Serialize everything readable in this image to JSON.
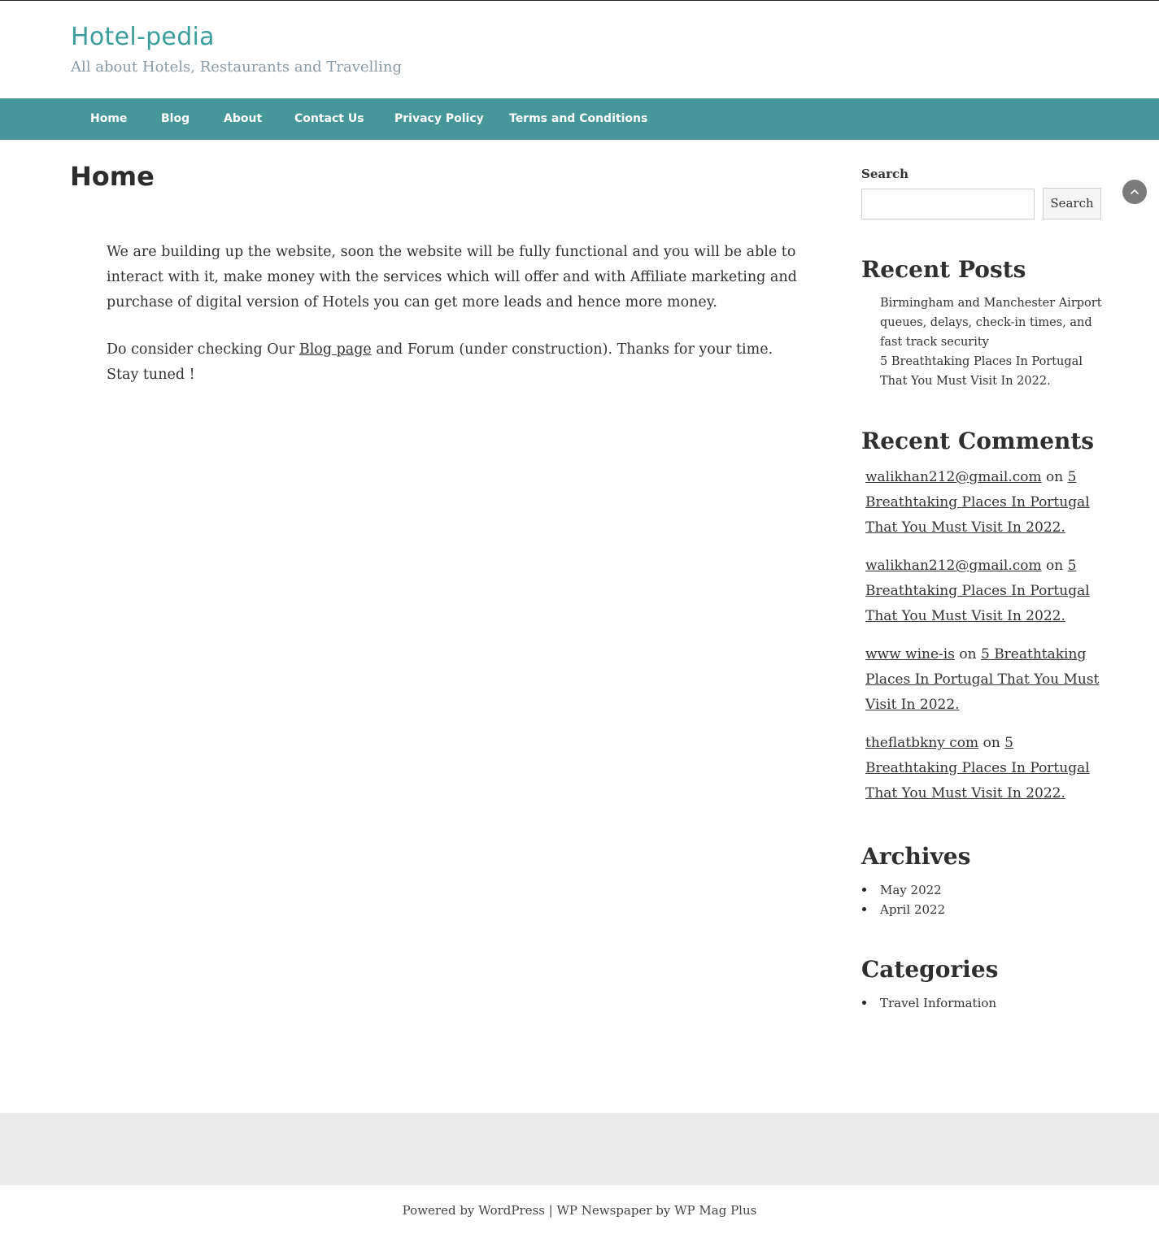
{
  "site": {
    "title": "Hotel-pedia",
    "tagline": "All about Hotels, Restaurants and Travelling"
  },
  "nav": {
    "items": [
      {
        "label": "Home"
      },
      {
        "label": "Blog"
      },
      {
        "label": "About"
      },
      {
        "label": "Contact Us"
      },
      {
        "label": "Privacy Policy"
      },
      {
        "label": "Terms and Conditions"
      }
    ]
  },
  "main": {
    "title": "Home",
    "paragraph1": "We are building up the website, soon the website will be fully functional and you will be able to interact with it, make money with the services which will offer and with Affiliate marketing and purchase of digital version of Hotels you can get more leads and hence more money.",
    "paragraph2_before": "Do consider checking Our ",
    "paragraph2_link": "Blog page",
    "paragraph2_after": " and Forum (under construction). Thanks for your time. Stay tuned !"
  },
  "sidebar": {
    "search": {
      "label": "Search",
      "placeholder": "",
      "button": "Search"
    },
    "recent_posts": {
      "heading": "Recent Posts",
      "items": [
        "Birmingham and Manchester Airport queues, delays, check-in times, and fast track security",
        "5 Breathtaking Places In Portugal That You Must Visit In 2022."
      ]
    },
    "recent_comments": {
      "heading": "Recent Comments",
      "connector": "on",
      "items": [
        {
          "author": "walikhan212@gmail.com",
          "post": "5 Breathtaking Places In Portugal That You Must Visit In 2022."
        },
        {
          "author": "walikhan212@gmail.com",
          "post": "5 Breathtaking Places In Portugal That You Must Visit In 2022."
        },
        {
          "author": "www wine-is",
          "post": "5 Breathtaking Places In Portugal That You Must Visit In 2022."
        },
        {
          "author": "theflatbkny com",
          "post": "5 Breathtaking Places In Portugal That You Must Visit In 2022."
        }
      ]
    },
    "archives": {
      "heading": "Archives",
      "items": [
        "May 2022",
        "April 2022"
      ]
    },
    "categories": {
      "heading": "Categories",
      "items": [
        "Travel Information"
      ]
    }
  },
  "footer": {
    "credit": "Powered by WordPress | WP Newspaper by WP Mag Plus"
  },
  "icons": {
    "scroll_top": "chevron-up-icon"
  },
  "colors": {
    "brand": "#3d9d9b",
    "nav_background": "#46969a",
    "footer_band": "#ebebeb"
  }
}
